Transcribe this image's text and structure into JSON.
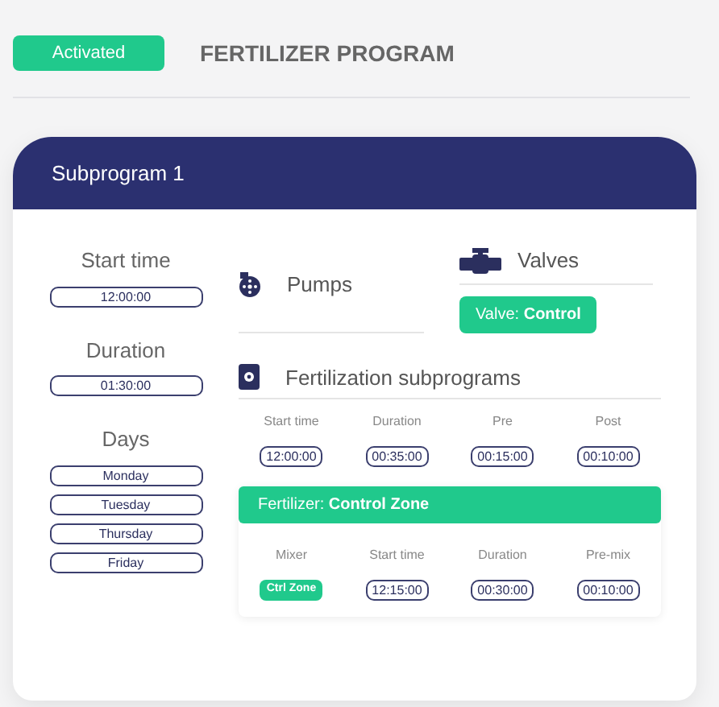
{
  "status_badge": "Activated",
  "title": "FERTILIZER PROGRAM",
  "subprogram": {
    "title": "Subprogram 1",
    "schedule": [
      {
        "label": "Start time",
        "values": [
          "12:00:00"
        ]
      },
      {
        "label": "Duration",
        "values": [
          "01:30:00"
        ]
      },
      {
        "label": "Days",
        "values": [
          "Monday",
          "Tuesday",
          "Thursday",
          "Friday"
        ]
      }
    ],
    "pumps": {
      "title": "Pumps"
    },
    "valves": {
      "title": "Valves",
      "tags": [
        "Valve: **Control**"
      ]
    },
    "fertilization": {
      "title": "Fertilization subprograms",
      "columns": [
        "Start time",
        "Duration",
        "Pre",
        "Post"
      ],
      "values": [
        "12:00:00",
        "00:35:00",
        "00:15:00",
        "00:10:00"
      ],
      "fertilizer": {
        "title": "Fertilizer: **Control Zone**",
        "columns": [
          "Mixer",
          "Start time",
          "Duration",
          "Pre-mix"
        ],
        "cells": [
          {
            "kind": "tag",
            "text": "Ctrl Zone"
          },
          {
            "kind": "time",
            "text": "12:15:00"
          },
          {
            "kind": "time",
            "text": "00:30:00"
          },
          {
            "kind": "time",
            "text": "00:10:00"
          }
        ]
      }
    }
  }
}
